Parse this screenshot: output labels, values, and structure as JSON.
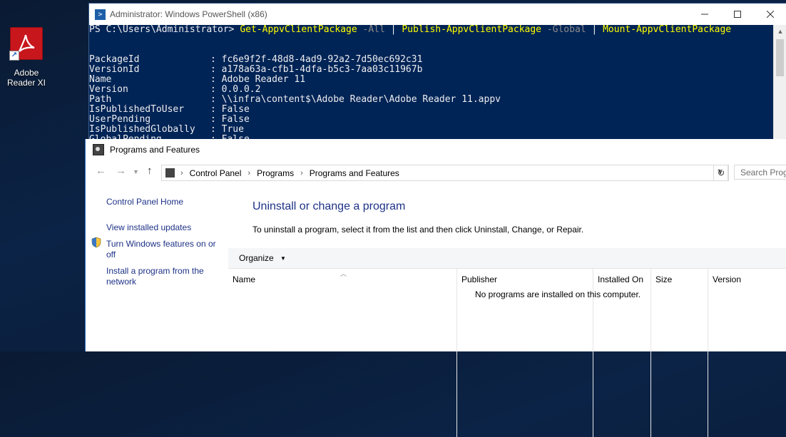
{
  "desktop": {
    "icon_label_line1": "Adobe",
    "icon_label_line2": "Reader XI"
  },
  "powershell": {
    "title": "Administrator: Windows PowerShell (x86)",
    "prompt": "PS C:\\Users\\Administrator> ",
    "cmd1": "Get-AppvClientPackage",
    "param1": " -All",
    "pipe1": " | ",
    "cmd2": "Publish-AppvClientPackage",
    "param2": " -Global",
    "pipe2": " | ",
    "cmd3": "Mount-AppvClientPackage",
    "output": [
      {
        "key": "PackageId",
        "value": "fc6e9f2f-48d8-4ad9-92a2-7d50ec692c31"
      },
      {
        "key": "VersionId",
        "value": "a178a63a-cfb1-4dfa-b5c3-7aa03c11967b"
      },
      {
        "key": "Name",
        "value": "Adobe Reader 11"
      },
      {
        "key": "Version",
        "value": "0.0.0.2"
      },
      {
        "key": "Path",
        "value": "\\\\infra\\content$\\Adobe Reader\\Adobe Reader 11.appv"
      },
      {
        "key": "IsPublishedToUser",
        "value": "False"
      },
      {
        "key": "UserPending",
        "value": "False"
      },
      {
        "key": "IsPublishedGlobally",
        "value": "True"
      },
      {
        "key": "GlobalPending",
        "value": "False"
      }
    ]
  },
  "programs": {
    "title": "Programs and Features",
    "breadcrumb": [
      "Control Panel",
      "Programs",
      "Programs and Features"
    ],
    "search_placeholder": "Search Prog",
    "sidebar": {
      "home": "Control Panel Home",
      "updates": "View installed updates",
      "features_line1": "Turn Windows features on or",
      "features_line2": "off",
      "install_line1": "Install a program from the",
      "install_line2": "network"
    },
    "heading": "Uninstall or change a program",
    "description": "To uninstall a program, select it from the list and then click Uninstall, Change, or Repair.",
    "organize": "Organize",
    "columns": [
      "Name",
      "Publisher",
      "Installed On",
      "Size",
      "Version"
    ],
    "empty_message": "No programs are installed on this computer."
  }
}
